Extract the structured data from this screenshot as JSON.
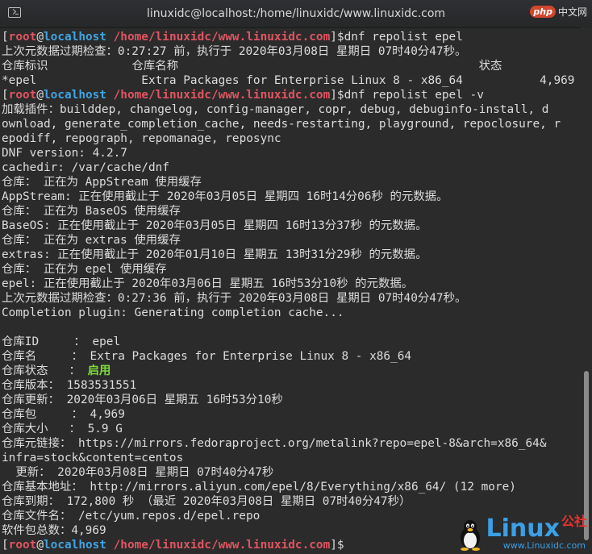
{
  "window": {
    "title": "linuxidc@localhost:/home/linuxidc/www.linuxidc.com"
  },
  "watermark_top": {
    "logo": "php",
    "site": "中文网"
  },
  "watermark_bottom": {
    "brand": "Linux",
    "suffix": "公社",
    "url": "www.Linuxidc.com"
  },
  "prompt": {
    "open": "[",
    "user": "root",
    "at": "@",
    "host": "localhost",
    "path": " /home/linuxidc/www.linuxidc.com",
    "close": "]",
    "symbol": "$"
  },
  "lines": {
    "cmd1": "dnf repolist epel",
    "l1": "上次元数据过期检查：0:27:27 前，执行于 2020年03月08日 星期日 07时40分47秒。",
    "l2": "仓库标识            仓库名称                                           状态",
    "l3": "*epel               Extra Packages for Enterprise Linux 8 - x86_64           4,969",
    "cmd2": "dnf repolist epel -v",
    "l4": "加载插件：builddep, changelog, config-manager, copr, debug, debuginfo-install, d",
    "l5": "ownload, generate_completion_cache, needs-restarting, playground, repoclosure, r",
    "l6": "epodiff, repograph, repomanage, reposync",
    "l7": "DNF version: 4.2.7",
    "l8": "cachedir: /var/cache/dnf",
    "l9": "仓库： 正在为 AppStream 使用缓存",
    "l10": "AppStream: 正在使用截止于 2020年03月05日 星期四 16时14分06秒 的元数据。",
    "l11": "仓库： 正在为 BaseOS 使用缓存",
    "l12": "BaseOS: 正在使用截止于 2020年03月05日 星期四 16时13分37秒 的元数据。",
    "l13": "仓库： 正在为 extras 使用缓存",
    "l14": "extras: 正在使用截止于 2020年01月10日 星期五 13时31分29秒 的元数据。",
    "l15": "仓库： 正在为 epel 使用缓存",
    "l16": "epel: 正在使用截止于 2020年03月06日 星期五 16时53分10秒 的元数据。",
    "l17": "上次元数据过期检查：0:27:36 前，执行于 2020年03月08日 星期日 07时40分47秒。",
    "l18": "Completion plugin: Generating completion cache...",
    "l19": "",
    "l20": "仓库ID     ： epel",
    "l21": "仓库名     ： Extra Packages for Enterprise Linux 8 - x86_64",
    "l22_label": "仓库状态   ： ",
    "l22_value": "启用",
    "l23": "仓库版本： 1583531551",
    "l24": "仓库更新： 2020年03月06日 星期五 16时53分10秒",
    "l25": "仓库包     ： 4,969",
    "l26": "仓库大小   ： 5.9 G",
    "l27": "仓库元链接： https://mirrors.fedoraproject.org/metalink?repo=epel-8&arch=x86_64&",
    "l28": "infra=stock&content=centos",
    "l29": "  更新： 2020年03月08日 星期日 07时40分47秒",
    "l30": "仓库基本地址： http://mirrors.aliyun.com/epel/8/Everything/x86_64/ (12 more)",
    "l31": "仓库到期： 172,800 秒 （最近 2020年03月08日 星期日 07时40分47秒）",
    "l32": "仓库文件名： /etc/yum.repos.d/epel.repo",
    "l33": "软件包总数：4,969"
  }
}
